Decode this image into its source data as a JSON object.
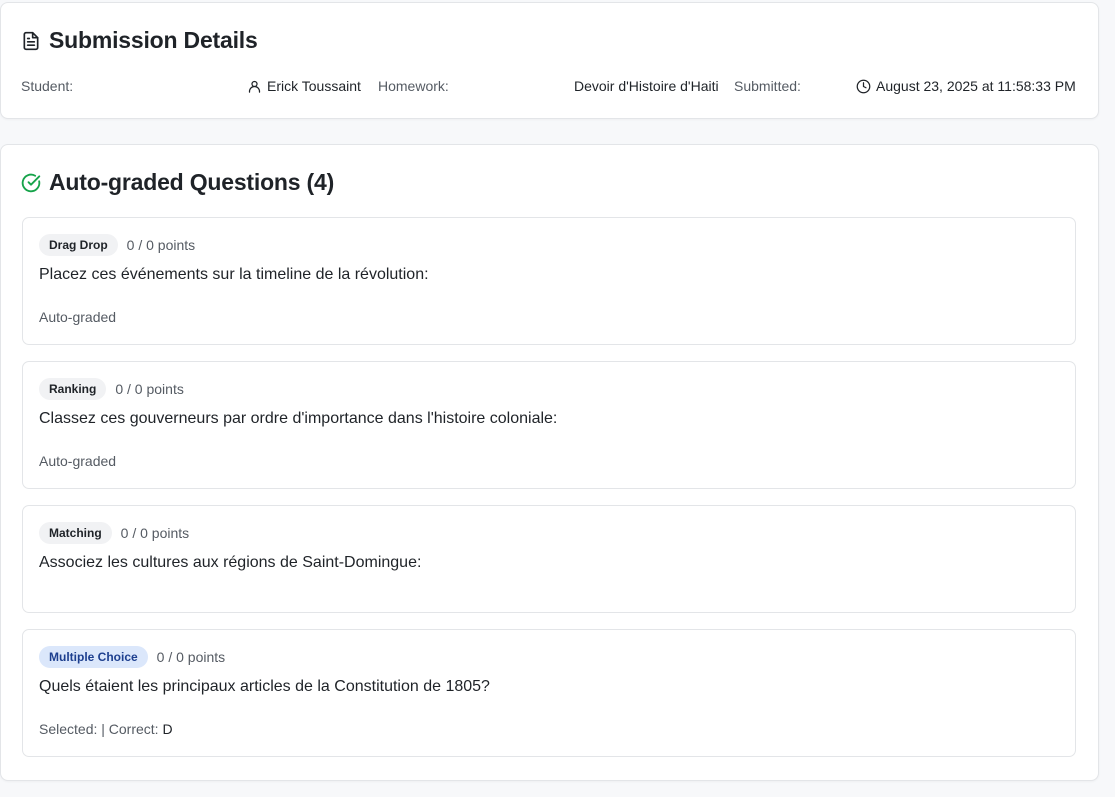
{
  "details": {
    "title": "Submission Details",
    "student_label": "Student:",
    "student_value": "Erick Toussaint",
    "homework_label": "Homework:",
    "homework_value": "Devoir d'Histoire d'Haiti",
    "submitted_label": "Submitted:",
    "submitted_value": "August 23, 2025 at 11:58:33 PM"
  },
  "autograded": {
    "title": "Auto-graded Questions (4)",
    "questions": [
      {
        "type": "Drag Drop",
        "points": "0 / 0 points",
        "text": "Placez ces événements sur la timeline de la révolution:",
        "footer": "Auto-graded"
      },
      {
        "type": "Ranking",
        "points": "0 / 0 points",
        "text": "Classez ces gouverneurs par ordre d'importance dans l'histoire coloniale:",
        "footer": "Auto-graded"
      },
      {
        "type": "Matching",
        "points": "0 / 0 points",
        "text": "Associez les cultures aux régions de Saint-Domingue:",
        "footer": ""
      },
      {
        "type": "Multiple Choice",
        "points": "0 / 0 points",
        "text": "Quels étaient les principaux articles de la Constitution de 1805?",
        "footer_selected": "Selected: | Correct:",
        "footer_correct": "D"
      }
    ]
  },
  "colors": {
    "success_icon": "#16a34a",
    "mc_badge_bg": "#dbe7fb",
    "mc_badge_text": "#1d3f8f"
  },
  "icons": {
    "details": "document-icon",
    "student": "user-icon",
    "submitted": "clock-icon",
    "autograded": "check-circle-icon"
  }
}
